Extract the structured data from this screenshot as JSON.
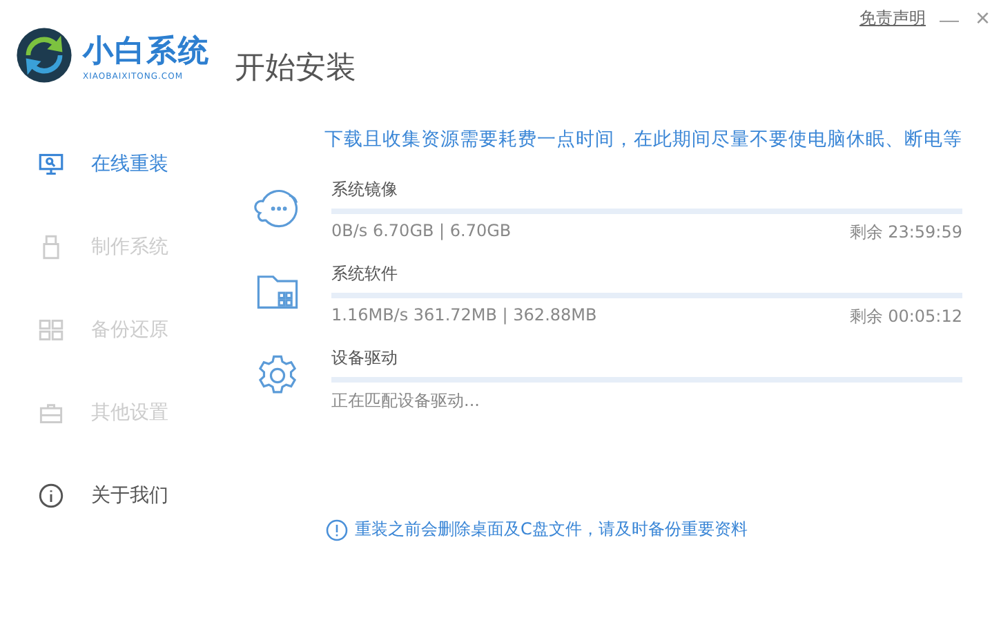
{
  "logo": {
    "name": "小白系统",
    "site": "XIAOBAIXITONG.COM"
  },
  "title": "开始安装",
  "top_bar": {
    "disclaimer": "免责声明",
    "minimize": "—",
    "close": "×"
  },
  "sidebar": {
    "items": [
      {
        "kind": "monitor",
        "label": "在线重装",
        "selected": true,
        "disabled": false
      },
      {
        "kind": "usb",
        "label": "制作系统",
        "selected": false,
        "disabled": true
      },
      {
        "kind": "backup",
        "label": "备份还原",
        "selected": false,
        "disabled": true
      },
      {
        "kind": "toolbox",
        "label": "其他设置",
        "selected": false,
        "disabled": true
      },
      {
        "kind": "info",
        "label": "关于我们",
        "selected": false,
        "disabled": false
      }
    ]
  },
  "notice": "下载且收集资源需要耗费一点时间，在此期间尽量不要使电脑休眠、断电等",
  "tasks": [
    {
      "kind": "image",
      "name": "系统镜像",
      "level": 0,
      "detail": "0B/s 6.70GB | 6.70GB",
      "remaining": "剩余 23:59:59"
    },
    {
      "kind": "software",
      "name": "系统软件",
      "level": 0,
      "detail": "1.16MB/s 361.72MB | 362.88MB",
      "remaining": "剩余 00:05:12"
    },
    {
      "kind": "driver",
      "name": "设备驱动",
      "level": 0,
      "detail": "正在匹配设备驱动..."
    }
  ],
  "warning": "重装之前会删除桌面及C盘文件，请及时备份重要资料"
}
